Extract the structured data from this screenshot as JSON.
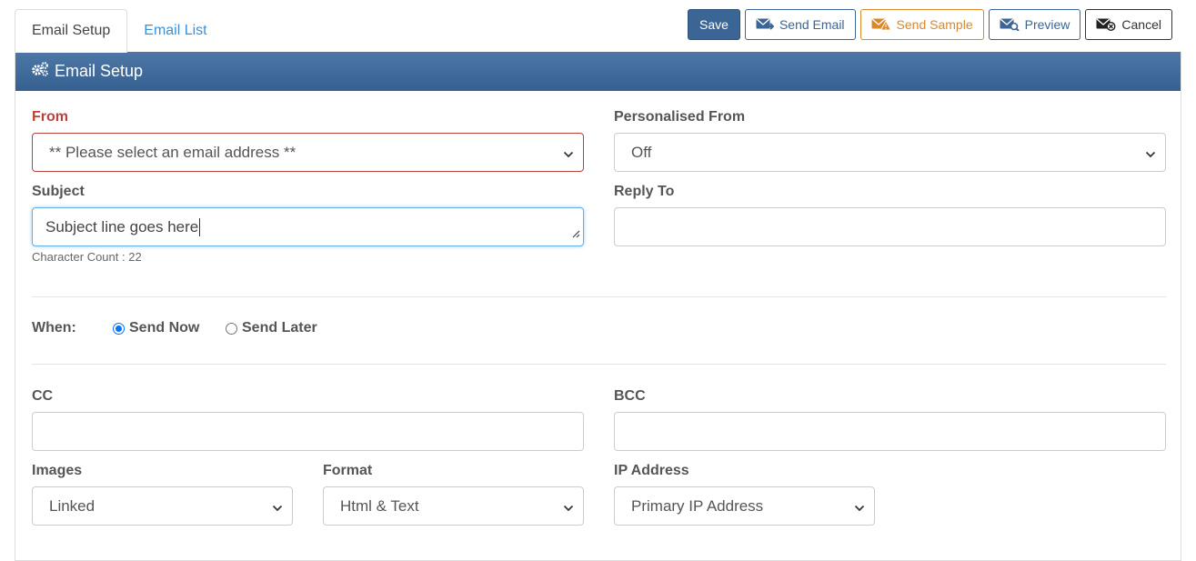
{
  "tabs": [
    {
      "label": "Email Setup",
      "active": true
    },
    {
      "label": "Email List",
      "active": false
    }
  ],
  "toolbar": {
    "save_label": "Save",
    "send_email_label": "Send Email",
    "send_sample_label": "Send Sample",
    "preview_label": "Preview",
    "cancel_label": "Cancel"
  },
  "panel": {
    "title": "Email Setup"
  },
  "form": {
    "from": {
      "label": "From",
      "value": "** Please select an email address **"
    },
    "personalised_from": {
      "label": "Personalised From",
      "value": "Off"
    },
    "subject": {
      "label": "Subject",
      "value": "Subject line goes here",
      "char_count": "Character Count : 22"
    },
    "reply_to": {
      "label": "Reply To",
      "value": ""
    },
    "when": {
      "label": "When:",
      "send_now": "Send Now",
      "send_later": "Send Later",
      "selected": "Send Now"
    },
    "cc": {
      "label": "CC",
      "value": ""
    },
    "bcc": {
      "label": "BCC",
      "value": ""
    },
    "images": {
      "label": "Images",
      "value": "Linked"
    },
    "format": {
      "label": "Format",
      "value": "Html & Text"
    },
    "ip_address": {
      "label": "IP Address",
      "value": "Primary IP Address"
    }
  },
  "colors": {
    "primary": "#3b6594",
    "warning": "#d9882a",
    "error": "#b7433d",
    "link": "#3a8fd6"
  }
}
